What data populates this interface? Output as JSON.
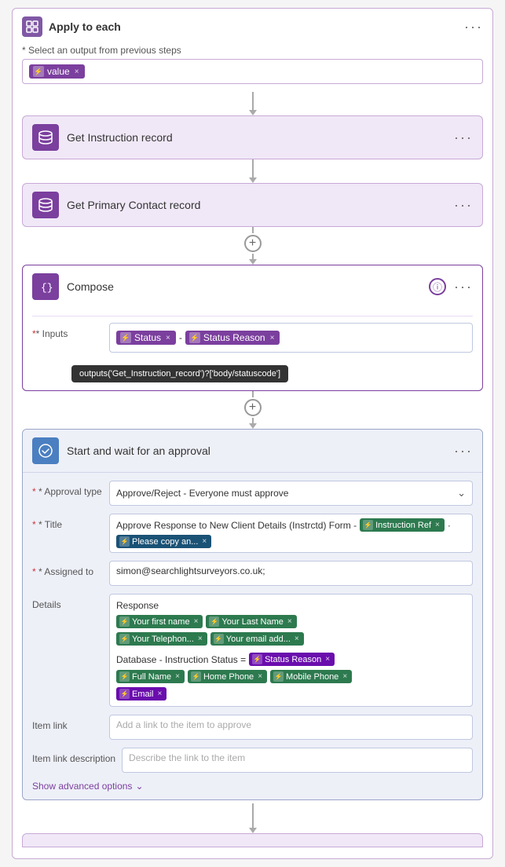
{
  "apply_to_each": {
    "title": "Apply to each",
    "select_label": "* Select an output from previous steps",
    "value_token": "value",
    "dots": "···"
  },
  "get_instruction": {
    "title": "Get Instruction record",
    "dots": "···"
  },
  "get_primary": {
    "title": "Get Primary Contact record",
    "dots": "···"
  },
  "compose": {
    "title": "Compose",
    "inputs_label": "* Inputs",
    "token1": "Status",
    "token2": "Status Reason",
    "dots": "···",
    "tooltip": "outputs('Get_Instruction_record')?['body/statuscode']"
  },
  "approval": {
    "title": "Start and wait for an approval",
    "dots": "···",
    "approval_type_label": "* Approval type",
    "approval_type_value": "Approve/Reject - Everyone must approve",
    "title_label": "* Title",
    "title_text": "Approve Response to New Client Details (Instrctd) Form -",
    "title_token1": "Instruction Ref",
    "title_token2": "Please copy an...",
    "assigned_label": "* Assigned to",
    "assigned_value": "simon@searchlightsurveyors.co.uk;",
    "details_label": "Details",
    "details_line1": "Response",
    "details_tokens": [
      {
        "label": "Your first name",
        "type": "green"
      },
      {
        "label": "Your Last Name",
        "type": "green"
      },
      {
        "label": "Your Telephon...",
        "type": "green"
      },
      {
        "label": "Your email add...",
        "type": "green"
      }
    ],
    "details_line2": "Database - Instruction Status =",
    "details_token_status": "Status Reason",
    "details_tokens2": [
      {
        "label": "Full Name",
        "type": "green"
      },
      {
        "label": "Home Phone",
        "type": "green"
      },
      {
        "label": "Mobile Phone",
        "type": "green"
      }
    ],
    "details_token_email": "Email",
    "item_link_label": "Item link",
    "item_link_placeholder": "Add a link to the item to approve",
    "item_link_desc_label": "Item link description",
    "item_link_desc_placeholder": "Describe the link to the item",
    "show_advanced": "Show advanced options"
  }
}
